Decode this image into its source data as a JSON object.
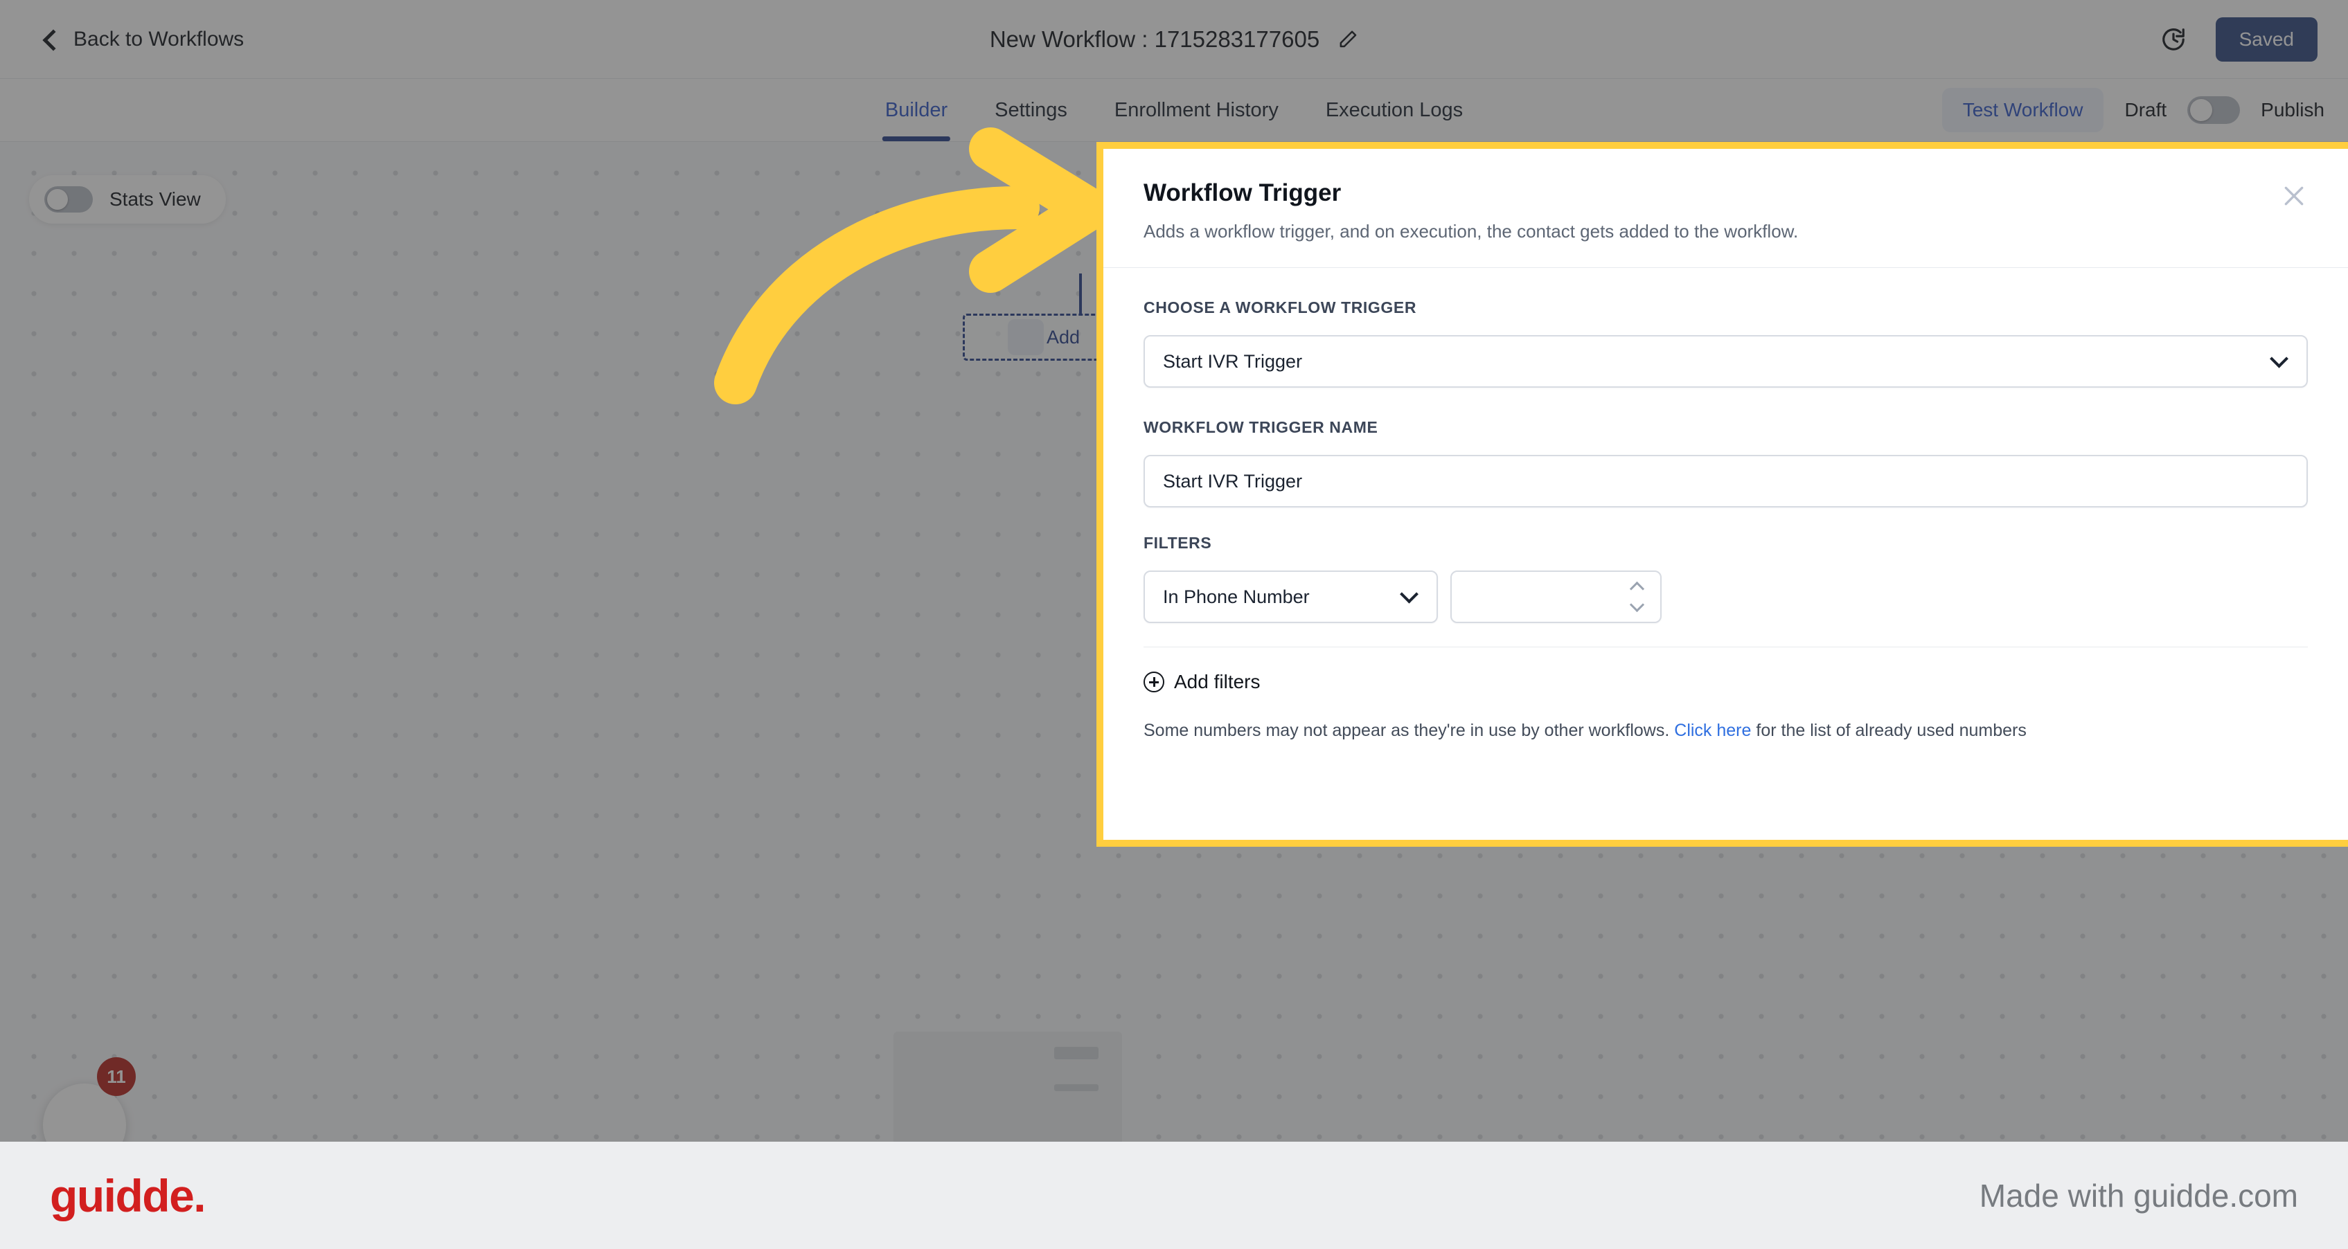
{
  "topbar": {
    "back_label": "Back to Workflows",
    "back_icon": "chevron-left-icon",
    "title": "New Workflow : 1715283177605",
    "edit_icon": "pencil-icon",
    "history_icon": "clock-rotate-icon",
    "saved_label": "Saved",
    "saved_color": "#2f4880"
  },
  "tabbar": {
    "tabs": [
      {
        "label": "Builder",
        "active": true
      },
      {
        "label": "Settings",
        "active": false
      },
      {
        "label": "Enrollment History",
        "active": false
      },
      {
        "label": "Execution Logs",
        "active": false
      }
    ],
    "active_color": "#2f56c7",
    "test_workflow_label": "Test Workflow",
    "draft_label": "Draft",
    "publish_label": "Publish",
    "publish_toggle_on": false
  },
  "canvas": {
    "stats_view_label": "Stats View",
    "stats_view_on": false,
    "node_label": "Add",
    "chat_badge_count": "11"
  },
  "modal": {
    "title": "Workflow Trigger",
    "subtitle": "Adds a workflow trigger, and on execution, the contact gets added to the workflow.",
    "close_icon": "close-icon",
    "border_color": "#FFCE3F",
    "choose_trigger_label": "Choose a workflow trigger",
    "choose_trigger_value": "Start IVR Trigger",
    "trigger_name_label": "Workflow trigger name",
    "trigger_name_value": "Start IVR Trigger",
    "filters_label": "Filters",
    "filter_field_value": "In Phone Number",
    "filter_number_value": "",
    "add_filters_label": "Add filters",
    "note_prefix": "Some numbers may not appear as they're in use by other workflows.",
    "note_link": "Click here",
    "note_suffix": "for the list of already used numbers"
  },
  "footer": {
    "logo": "guidde.",
    "made_with": "Made with guidde.com"
  }
}
